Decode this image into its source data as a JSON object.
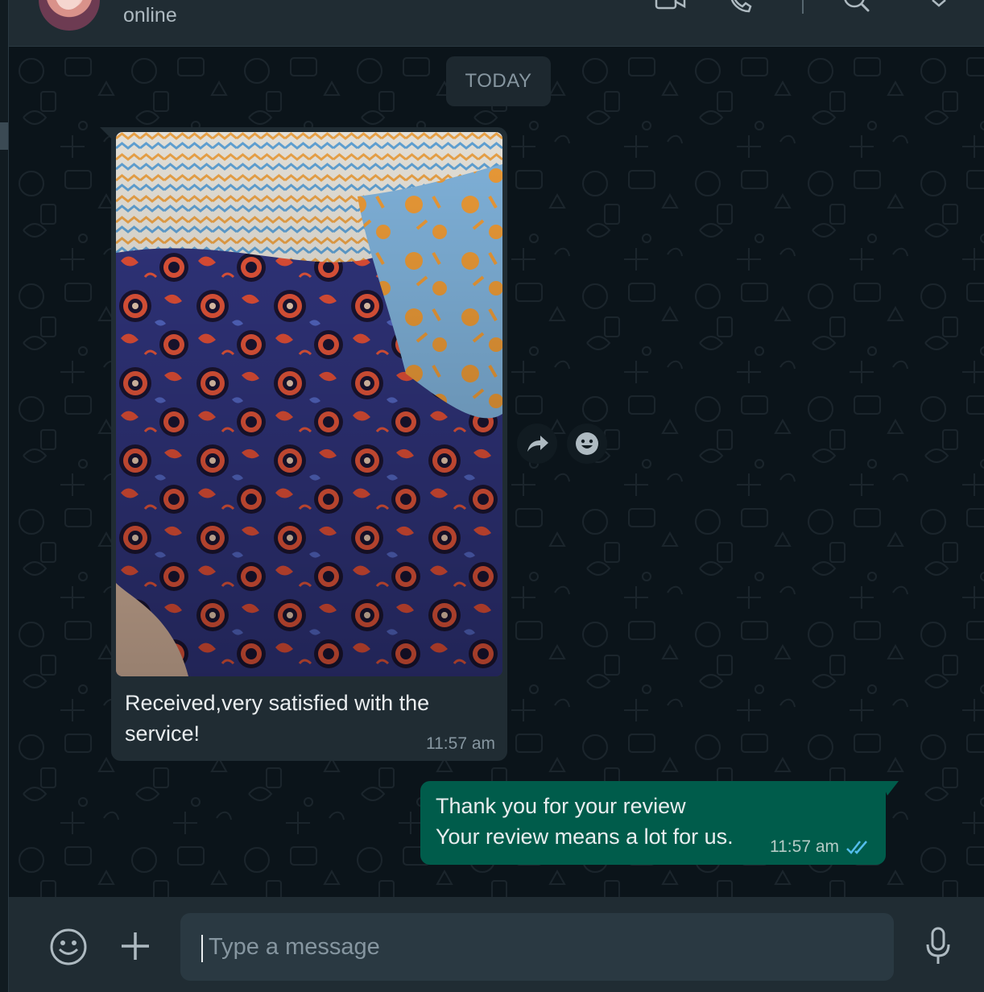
{
  "header": {
    "status": "online",
    "icons": [
      "video-call-icon",
      "voice-call-icon",
      "search-icon",
      "chevron-down-icon"
    ]
  },
  "chat": {
    "date_chip": "TODAY",
    "messages": [
      {
        "direction": "incoming",
        "type": "image",
        "image_description": "photo of blue and orange floral printed fabric",
        "caption": "Received,very satisfied with the service!",
        "time": "11:57 am"
      },
      {
        "direction": "outgoing",
        "lines": [
          "Thank you for your review",
          "Your review means a lot for us."
        ],
        "time": "11:57 am",
        "read_status": "read"
      }
    ],
    "hover_actions": [
      "forward-icon",
      "emoji-reaction-icon"
    ]
  },
  "composer": {
    "placeholder": "Type a message",
    "icons": [
      "emoji-icon",
      "plus-icon",
      "microphone-icon"
    ]
  },
  "colors": {
    "app_bg": "#0b141a",
    "panel": "#202c33",
    "incoming_bubble": "#202c33",
    "outgoing_bubble": "#005c4b",
    "read_ticks": "#53bdeb",
    "secondary_text": "#8696a0"
  }
}
